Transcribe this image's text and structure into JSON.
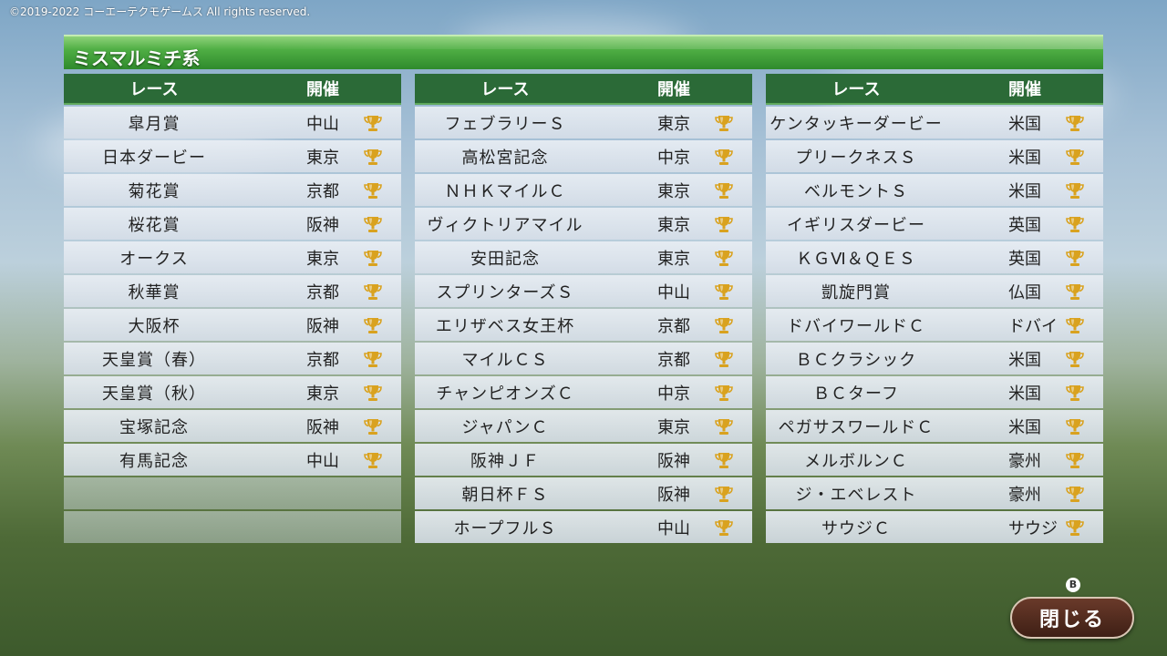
{
  "copyright": "©2019-2022 コーエーテクモゲームス All rights reserved.",
  "title": "ミスマルミチ系",
  "headers": {
    "race": "レース",
    "venue": "開催"
  },
  "tables": [
    {
      "rows": [
        {
          "race": "皐月賞",
          "venue": "中山"
        },
        {
          "race": "日本ダービー",
          "venue": "東京"
        },
        {
          "race": "菊花賞",
          "venue": "京都"
        },
        {
          "race": "桜花賞",
          "venue": "阪神"
        },
        {
          "race": "オークス",
          "venue": "東京"
        },
        {
          "race": "秋華賞",
          "venue": "京都"
        },
        {
          "race": "大阪杯",
          "venue": "阪神"
        },
        {
          "race": "天皇賞（春）",
          "venue": "京都"
        },
        {
          "race": "天皇賞（秋）",
          "venue": "東京"
        },
        {
          "race": "宝塚記念",
          "venue": "阪神"
        },
        {
          "race": "有馬記念",
          "venue": "中山"
        }
      ]
    },
    {
      "rows": [
        {
          "race": "フェブラリーＳ",
          "venue": "東京"
        },
        {
          "race": "高松宮記念",
          "venue": "中京"
        },
        {
          "race": "ＮＨＫマイルＣ",
          "venue": "東京"
        },
        {
          "race": "ヴィクトリアマイル",
          "venue": "東京"
        },
        {
          "race": "安田記念",
          "venue": "東京"
        },
        {
          "race": "スプリンターズＳ",
          "venue": "中山"
        },
        {
          "race": "エリザベス女王杯",
          "venue": "京都"
        },
        {
          "race": "マイルＣＳ",
          "venue": "京都"
        },
        {
          "race": "チャンピオンズＣ",
          "venue": "中京"
        },
        {
          "race": "ジャパンＣ",
          "venue": "東京"
        },
        {
          "race": "阪神ＪＦ",
          "venue": "阪神"
        },
        {
          "race": "朝日杯ＦＳ",
          "venue": "阪神"
        },
        {
          "race": "ホープフルＳ",
          "venue": "中山"
        }
      ]
    },
    {
      "rows": [
        {
          "race": "ケンタッキーダービー",
          "venue": "米国"
        },
        {
          "race": "プリークネスＳ",
          "venue": "米国"
        },
        {
          "race": "ベルモントＳ",
          "venue": "米国"
        },
        {
          "race": "イギリスダービー",
          "venue": "英国"
        },
        {
          "race": "ＫＧⅥ＆ＱＥＳ",
          "venue": "英国"
        },
        {
          "race": "凱旋門賞",
          "venue": "仏国"
        },
        {
          "race": "ドバイワールドＣ",
          "venue": "ドバイ"
        },
        {
          "race": "ＢＣクラシック",
          "venue": "米国"
        },
        {
          "race": "ＢＣターフ",
          "venue": "米国"
        },
        {
          "race": "ペガサスワールドＣ",
          "venue": "米国"
        },
        {
          "race": "メルボルンＣ",
          "venue": "豪州"
        },
        {
          "race": "ジ・エベレスト",
          "venue": "豪州"
        },
        {
          "race": "サウジＣ",
          "venue": "サウジ"
        }
      ]
    }
  ],
  "close_button": {
    "label": "閉じる",
    "hint": "B"
  },
  "colors": {
    "header_bg": "#2b6a37",
    "title_green": "#4fae44",
    "trophy_gold": "#d9a21f"
  }
}
